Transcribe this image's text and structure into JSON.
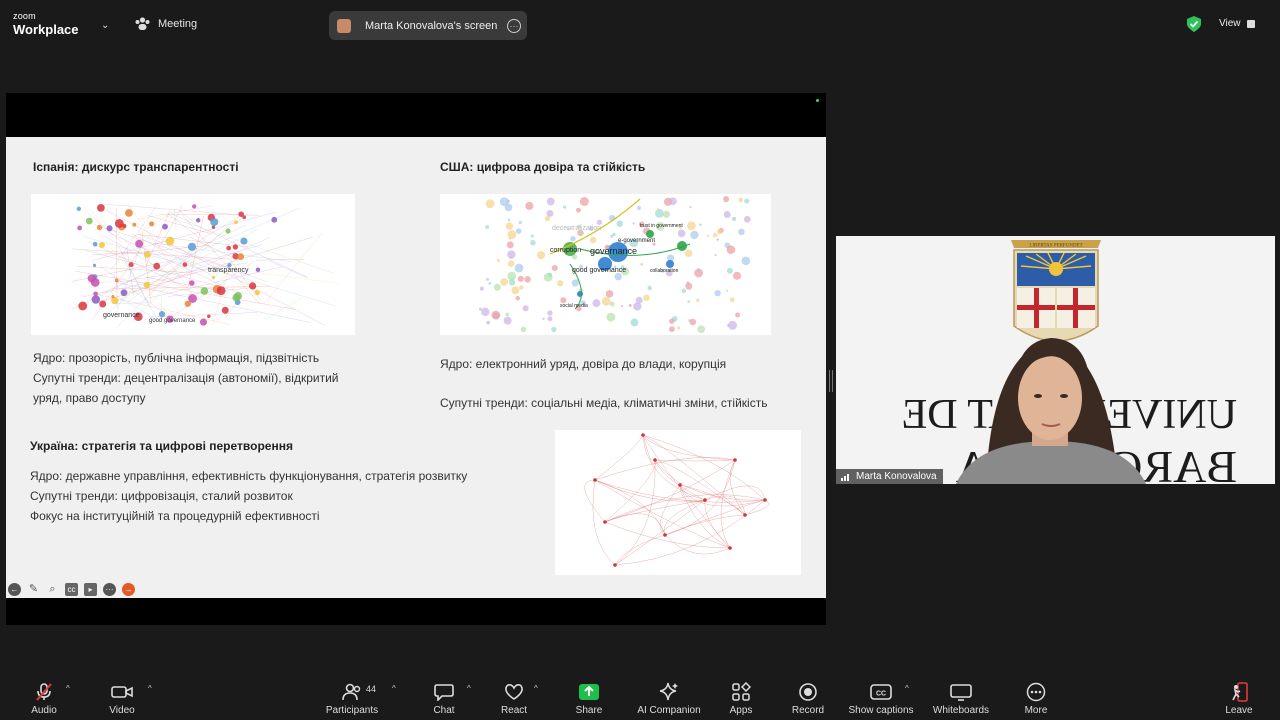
{
  "app": {
    "brand_small": "zoom",
    "brand_big": "Workplace",
    "meeting_label": "Meeting",
    "screen_share_label": "Marta Konovalova's screen",
    "view_label": "View"
  },
  "slide": {
    "spain_heading": "Іспанія: дискурс транспарентності",
    "spain_lines": [
      "Ядро: прозорість, публічна інформація, підзвітність",
      "Супутні тренди: децентралізація (автономії), відкритий",
      "уряд, право доступу"
    ],
    "usa_heading": "США: цифрова довіра та стійкість",
    "usa_line1": "Ядро: електронний уряд, довіра до влади, корупція",
    "usa_line2": "Супутні тренди: соціальні медіа, кліматичні зміни, стійкість",
    "ukraine_heading": "Україна: стратегія та цифрові перетворення",
    "ukraine_lines": [
      "Ядро: державне управління, ефективність функціонування, стратегія розвитку",
      "Супутні тренди: цифровізація, сталий розвиток",
      "Фокус на інституційній та процедурній ефективності"
    ],
    "spain_map_labels": [
      "transparency",
      "governance",
      "good governance"
    ],
    "usa_map_labels": [
      "corruption",
      "governance",
      "good governance",
      "e-government",
      "trust in government",
      "social media",
      "collaboration",
      "decentralization"
    ]
  },
  "video": {
    "participant_name": "Marta Konovalova",
    "bg_text_line1": "UNIVERSITAT DE",
    "bg_text_line2": "BARCELONA",
    "banner": "LIBERTAS PERFUNDET"
  },
  "toolbar": {
    "audio": "Audio",
    "video": "Video",
    "participants": "Participants",
    "participants_count": "44",
    "chat": "Chat",
    "react": "React",
    "share": "Share",
    "ai": "AI Companion",
    "apps": "Apps",
    "record": "Record",
    "captions": "Show captions",
    "whiteboards": "Whiteboards",
    "more": "More",
    "leave": "Leave"
  },
  "colors": {
    "share_green": "#1dbf4a",
    "leave_red": "#e03a3a",
    "secure_green": "#2ec35a"
  }
}
